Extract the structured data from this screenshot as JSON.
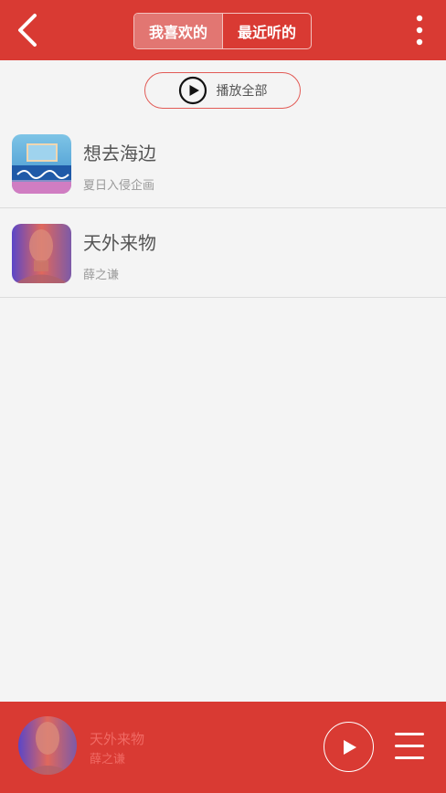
{
  "header": {
    "tabs": [
      {
        "label": "我喜欢的",
        "active": true
      },
      {
        "label": "最近听的",
        "active": false
      }
    ],
    "back_icon": "chevron-left-icon",
    "more_icon": "more-vertical-icon",
    "accent_color": "#d93a33"
  },
  "play_all": {
    "label": "播放全部",
    "icon": "play-circle-icon"
  },
  "songs": [
    {
      "title": "想去海边",
      "artist": "夏日入侵企画"
    },
    {
      "title": "天外来物",
      "artist": "薛之谦"
    }
  ],
  "player": {
    "title": "天外来物",
    "artist": "薛之谦",
    "play_icon": "play-icon",
    "menu_icon": "playlist-menu-icon"
  }
}
